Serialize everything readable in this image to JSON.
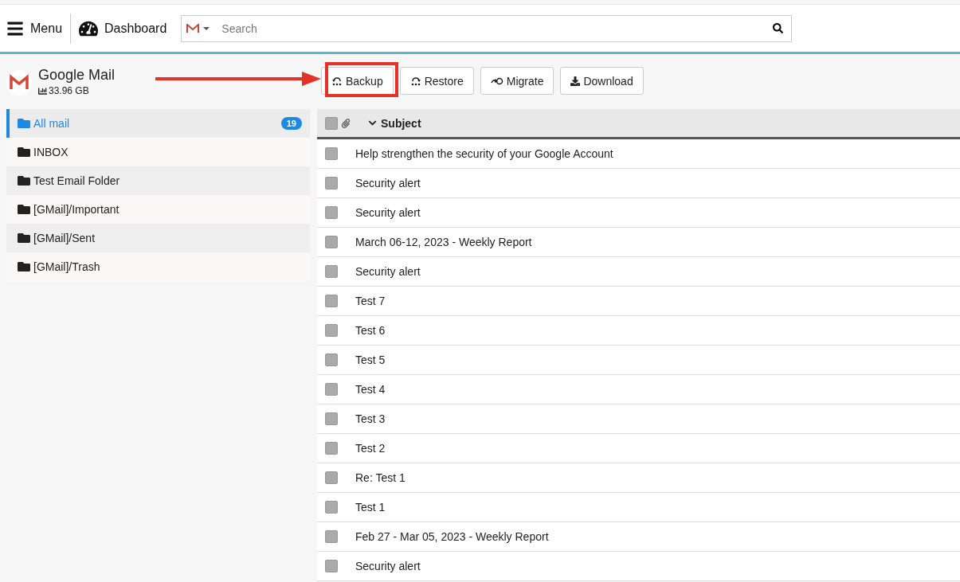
{
  "topbar": {
    "menu_label": "Menu",
    "dashboard_label": "Dashboard",
    "search": {
      "placeholder": "Search"
    }
  },
  "account": {
    "name": "Google Mail",
    "size": "33.96 GB"
  },
  "actions": [
    {
      "label": "Backup",
      "kind": "backup",
      "highlighted": true
    },
    {
      "label": "Restore",
      "kind": "restore",
      "highlighted": false
    },
    {
      "label": "Migrate",
      "kind": "migrate",
      "highlighted": false
    },
    {
      "label": "Download",
      "kind": "download",
      "highlighted": false
    }
  ],
  "folders": [
    {
      "name": "All mail",
      "selected": true,
      "count": "19"
    },
    {
      "name": "INBOX",
      "selected": false
    },
    {
      "name": "Test Email Folder",
      "selected": false
    },
    {
      "name": "[GMail]/Important",
      "selected": false
    },
    {
      "name": "[GMail]/Sent",
      "selected": false
    },
    {
      "name": "[GMail]/Trash",
      "selected": false
    }
  ],
  "table": {
    "header_checked": false,
    "subject_column": "Subject",
    "rows": [
      {
        "subject": "Help strengthen the security of your Google Account",
        "checked": false
      },
      {
        "subject": "Security alert",
        "checked": false
      },
      {
        "subject": "Security alert",
        "checked": false
      },
      {
        "subject": "March 06-12, 2023 - Weekly Report",
        "checked": false
      },
      {
        "subject": "Security alert",
        "checked": false
      },
      {
        "subject": "Test 7",
        "checked": false
      },
      {
        "subject": "Test 6",
        "checked": false
      },
      {
        "subject": "Test 5",
        "checked": false
      },
      {
        "subject": "Test 4",
        "checked": false
      },
      {
        "subject": "Test 3",
        "checked": false
      },
      {
        "subject": "Test 2",
        "checked": false
      },
      {
        "subject": "Re: Test 1",
        "checked": false
      },
      {
        "subject": "Test 1",
        "checked": false
      },
      {
        "subject": "Feb 27 - Mar 05, 2023 - Weekly Report",
        "checked": false
      },
      {
        "subject": "Security alert",
        "checked": false
      }
    ]
  }
}
